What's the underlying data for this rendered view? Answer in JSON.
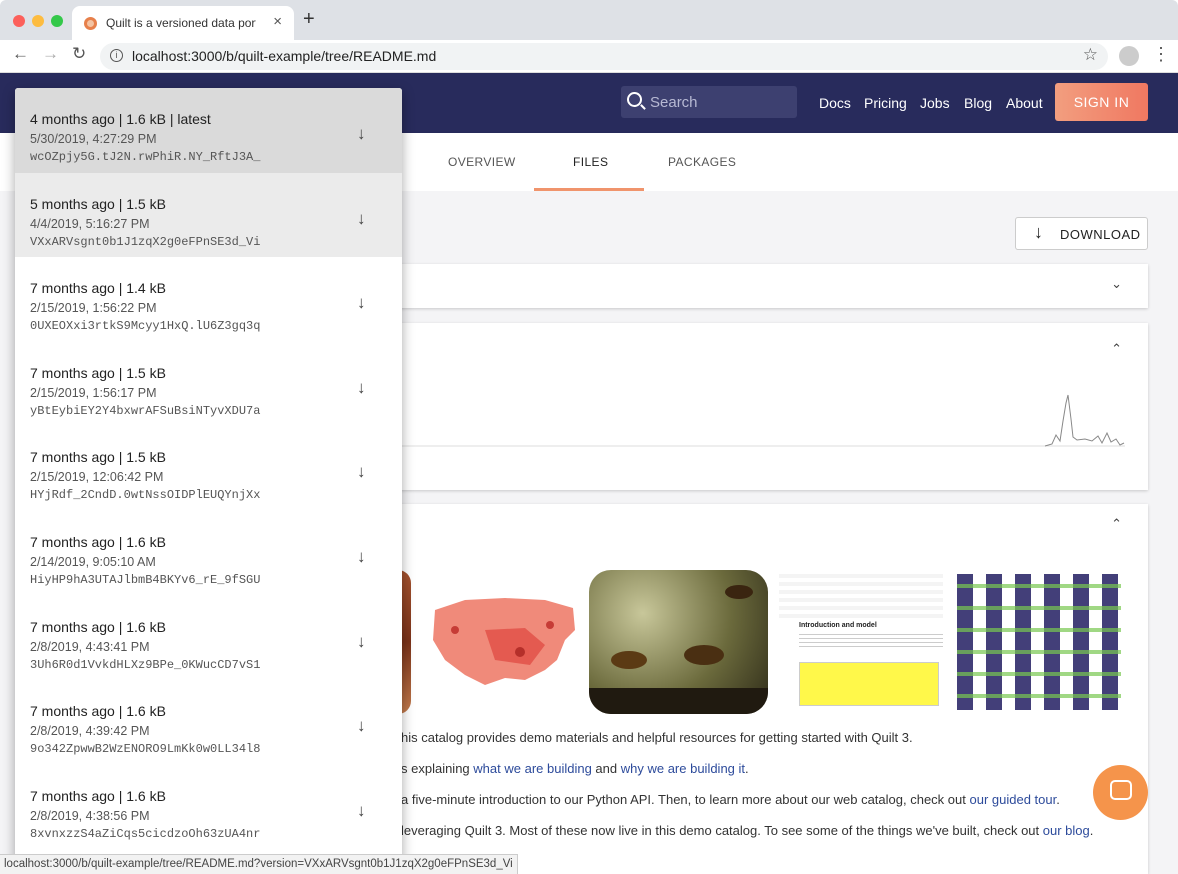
{
  "browser": {
    "tab_title": "Quilt is a versioned data portal",
    "tab_close": "×",
    "new_tab": "+",
    "url": "localhost:3000/b/quilt-example/tree/README.md",
    "back": "←",
    "forward": "→",
    "reload": "↻",
    "star": "☆",
    "menu": "⋮",
    "info": "i"
  },
  "header": {
    "search_placeholder": "Search",
    "links": [
      "Docs",
      "Pricing",
      "Jobs",
      "Blog",
      "About"
    ],
    "signin_label": "SIGN IN"
  },
  "subnav": {
    "tabs": [
      "OVERVIEW",
      "FILES",
      "PACKAGES"
    ],
    "active": "FILES"
  },
  "download_label": "DOWNLOAD",
  "download_arrow": "↓",
  "chevron_down": "⌄",
  "chevron_up": "⌃",
  "versions": [
    {
      "summary": "4 months ago | 1.6 kB | latest",
      "date": "5/30/2019, 4:27:29 PM",
      "id": "wcOZpjy5G.tJ2N.rwPhiR.NY_RftJ3A_"
    },
    {
      "summary": "5 months ago | 1.5 kB",
      "date": "4/4/2019, 5:16:27 PM",
      "id": "VXxARVsgnt0b1J1zqX2g0eFPnSE3d_Vi"
    },
    {
      "summary": "7 months ago | 1.4 kB",
      "date": "2/15/2019, 1:56:22 PM",
      "id": "0UXEOXxi3rtkS9Mcyy1HxQ.lU6Z3gq3q"
    },
    {
      "summary": "7 months ago | 1.5 kB",
      "date": "2/15/2019, 1:56:17 PM",
      "id": "yBtEybiEY2Y4bxwrAFSuBsiNTyvXDU7a"
    },
    {
      "summary": "7 months ago | 1.5 kB",
      "date": "2/15/2019, 12:06:42 PM",
      "id": "HYjRdf_2CndD.0wtNssOIDPlEUQYnjXx"
    },
    {
      "summary": "7 months ago | 1.6 kB",
      "date": "2/14/2019, 9:05:10 AM",
      "id": "HiyHP9hA3UTAJlbmB4BKYv6_rE_9fSGU"
    },
    {
      "summary": "7 months ago | 1.6 kB",
      "date": "2/8/2019, 4:43:41 PM",
      "id": "3Uh6R0d1VvkdHLXz9BPe_0KWucCD7vS1"
    },
    {
      "summary": "7 months ago | 1.6 kB",
      "date": "2/8/2019, 4:39:42 PM",
      "id": "9o342ZpwwB2WzENORO9LmKk0w0LL34l8"
    },
    {
      "summary": "7 months ago | 1.6 kB",
      "date": "2/8/2019, 4:38:56 PM",
      "id": "8xvnxzzS4aZiCqs5cicdzoOh63zUA4nr"
    }
  ],
  "readme": {
    "line1": "his catalog provides demo materials and helpful resources for getting started with Quilt 3.",
    "line2_pre": "s explaining ",
    "line2_link1": "what we are building",
    "line2_mid": " and ",
    "line2_link2": "why we are building it",
    "line2_post": ".",
    "line3_pre": "a five-minute introduction to our Python API. Then, to learn more about our web catalog, check out ",
    "line3_link": "our guided tour",
    "line3_post": ".",
    "line4_pre": "leveraging Quilt 3. Most of these now live in this demo catalog. To see some of the things we've built, check out ",
    "line4_link": "our blog",
    "line4_post": "."
  },
  "notebook_text": {
    "heading": "Introduction and model"
  },
  "status_url": "localhost:3000/b/quilt-example/tree/README.md?version=VXxARVsgnt0b1J1zqX2g0eFPnSE3d_Vi",
  "colors": {
    "appbar": "#282b5c",
    "accent": "#f0946c",
    "link": "#2d4b9b",
    "chat": "#f5944b"
  }
}
